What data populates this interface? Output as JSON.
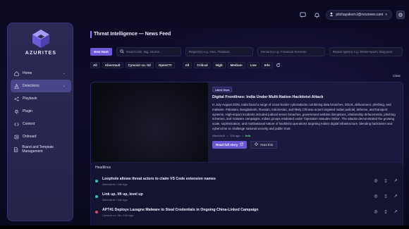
{
  "topbar": {
    "user_email": "pitchayakorn.l@rvconnex.com"
  },
  "sidebar": {
    "brand": "AZURITES",
    "items": [
      {
        "label": "Home",
        "icon": "home-icon",
        "has_chevron": true
      },
      {
        "label": "Detections",
        "icon": "warning-icon",
        "has_chevron": true,
        "active": true
      },
      {
        "label": "Playbook",
        "icon": "share-icon"
      },
      {
        "label": "Plugin",
        "icon": "plug-icon"
      },
      {
        "label": "Context",
        "icon": "code-icon"
      },
      {
        "label": "Onboard",
        "icon": "onboard-icon"
      },
      {
        "label": "Brand and Template Management",
        "icon": "document-icon"
      }
    ]
  },
  "main": {
    "title": "Threat Intelligence — News Feed",
    "new_hunt_label": "New Hunt",
    "search_placeholder": "Search title, tag, source...",
    "region_placeholder": "Region(s) e.g. Asia, Thailand",
    "sector_placeholder": "Sector(s) e.g. Financial Services",
    "report_placeholder": "Report type(s) e.g. threat-report, blog-post",
    "source_chips": [
      "All",
      "AlienVault",
      "Cyncixir co. ltd",
      "OpenCTI"
    ],
    "severity_chips": [
      "All",
      "Critical",
      "High",
      "Medium",
      "Low",
      "Info"
    ],
    "clear_label": "Clear"
  },
  "featured": {
    "badge": "Latest News",
    "title": "Digital Frontlines: India Under Multi-Nation Hacktivist Attack",
    "description": "In July-August 2025, India faced a surge of cross-border cyberattacks combining data breaches, DDoS, defacement, phishing, and malware. Pakistani, Bangladeshi, Russian, Indonesian, and likely Chinese actors targeted Indian judicial, defense, and transport systems. High-impact incidents included judicial server breaches, government website disruptions, relationship defacements, phishing schemes, and malware campaigns. Indian groups retaliated under 'Operation Vasudev Strike'. The attacks demonstrated the growing scale, sophistication, and multinational nature of hacktivist operations targeting India's digital infrastructure, blending hacktivism and cybercrime to challenge national security and public trust.",
    "source": "AlienVault",
    "age": "15h ago",
    "severity": "Info",
    "read_label": "Read full story",
    "hunt_label": "Hunt this"
  },
  "headlines": {
    "title": "Headlines",
    "items": [
      {
        "title": "Loophole allows threat actors to claim VS Code extension names",
        "source": "AlienVault",
        "age": "18d ago",
        "dot_color": "#28c8c0"
      },
      {
        "title": "Link up, lift up, level up",
        "source": "AlienVault",
        "age": "18d ago",
        "dot_color": "#28c8c0"
      },
      {
        "title": "APT41 Deploys Lazagne Malware to Steal Credentials in Ongoing China-Linked Campaign",
        "source": "Cyncixir co. ltd",
        "age": "19d ago",
        "dot_color": "#e04a6a"
      }
    ]
  }
}
